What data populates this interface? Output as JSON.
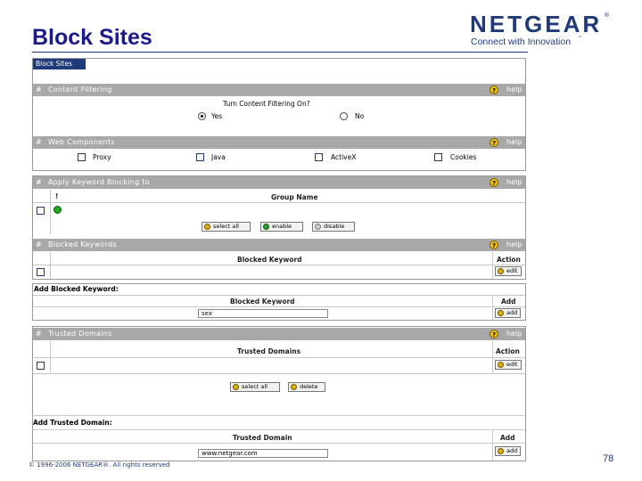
{
  "slide": {
    "title": "Block Sites",
    "logo_word": "NETGEAR",
    "logo_reg": "®",
    "logo_tagline": "Connect with Innovation",
    "logo_tm": "™",
    "footer": "© 1996-2006 NETGEAR®. All rights reserved",
    "page_number": "78"
  },
  "tab": {
    "label": "Block Sites"
  },
  "content_filtering": {
    "header": "Content Filtering",
    "help": "help",
    "question": "Turn Content Filtering On?",
    "options": [
      {
        "label": "Yes",
        "selected": true
      },
      {
        "label": "No",
        "selected": false
      }
    ]
  },
  "web_components": {
    "header": "Web Components",
    "help": "help",
    "items": [
      "Proxy",
      "Java",
      "ActiveX",
      "Cookies"
    ]
  },
  "apply_keyword": {
    "header": "Apply Keyword Blocking to",
    "help": "help",
    "col_index": "!",
    "col_group": "Group Name",
    "buttons": [
      "select all",
      "enable",
      "disable"
    ]
  },
  "blocked_keywords": {
    "header": "Blocked Keywords",
    "help": "help",
    "col_keyword": "Blocked Keyword",
    "col_action": "Action",
    "edit": "edit"
  },
  "add_blocked_keyword": {
    "header": "Add Blocked Keyword:",
    "col_keyword": "Blocked Keyword",
    "col_add": "Add",
    "value": "sex",
    "add_button": "add"
  },
  "trusted_domains": {
    "header": "Trusted Domains",
    "help": "help",
    "col_domains": "Trusted Domains",
    "col_action": "Action",
    "edit": "edit",
    "buttons": [
      "select all",
      "delete"
    ]
  },
  "add_trusted_domain": {
    "header": "Add Trusted Domain:",
    "col_domain": "Trusted Domain",
    "col_add": "Add",
    "value": "www.netgear.com",
    "add_button": "add"
  },
  "colors": {
    "title": "#1a1a8c",
    "logo": "#1f3a7a",
    "bar": "#a8a8a8",
    "help_icon": "#f1c40f"
  }
}
